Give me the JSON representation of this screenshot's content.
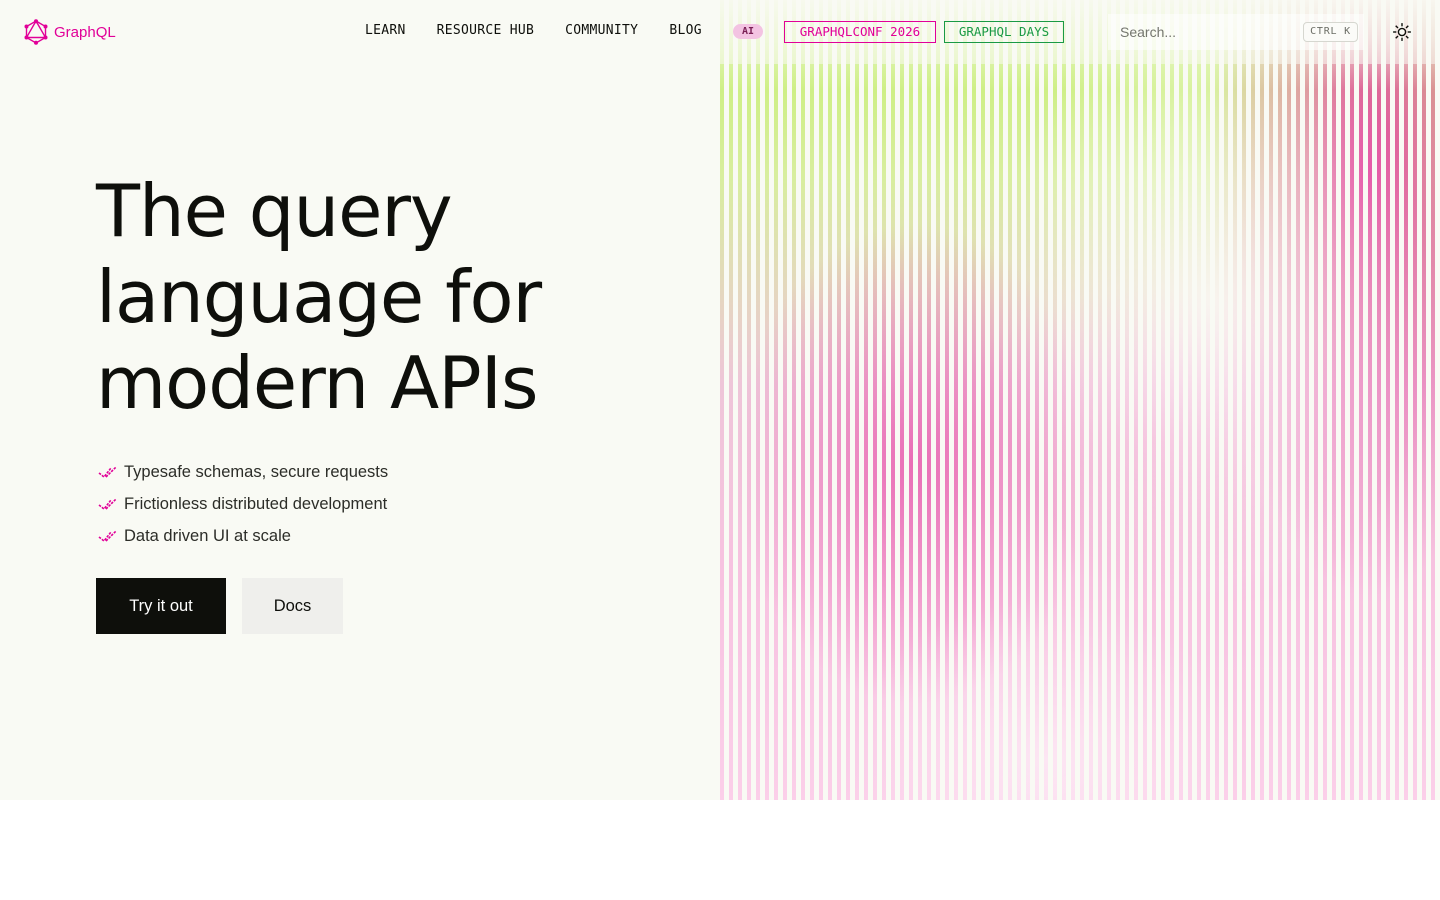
{
  "brand": {
    "name": "GraphQL",
    "color": "#e10098"
  },
  "nav": {
    "links": [
      "LEARN",
      "RESOURCE HUB",
      "COMMUNITY",
      "BLOG"
    ],
    "ai_badge": "AI",
    "conf_button": "GRAPHQLCONF 2026",
    "days_button": "GRAPHQL DAYS"
  },
  "search": {
    "placeholder": "Search...",
    "shortcut": "CTRL K"
  },
  "theme_toggle_icon": "sun-icon",
  "hero": {
    "headline": [
      "The query",
      "language for",
      "modern APIs"
    ],
    "features": [
      "Typesafe schemas, secure requests",
      "Frictionless distributed development",
      "Data driven UI at scale"
    ],
    "primary_cta": "Try it out",
    "secondary_cta": "Docs"
  },
  "colors": {
    "accent_pink": "#e10098",
    "accent_green": "#1a9a45",
    "background": "#f9faf4",
    "text": "#0e0f0b"
  }
}
